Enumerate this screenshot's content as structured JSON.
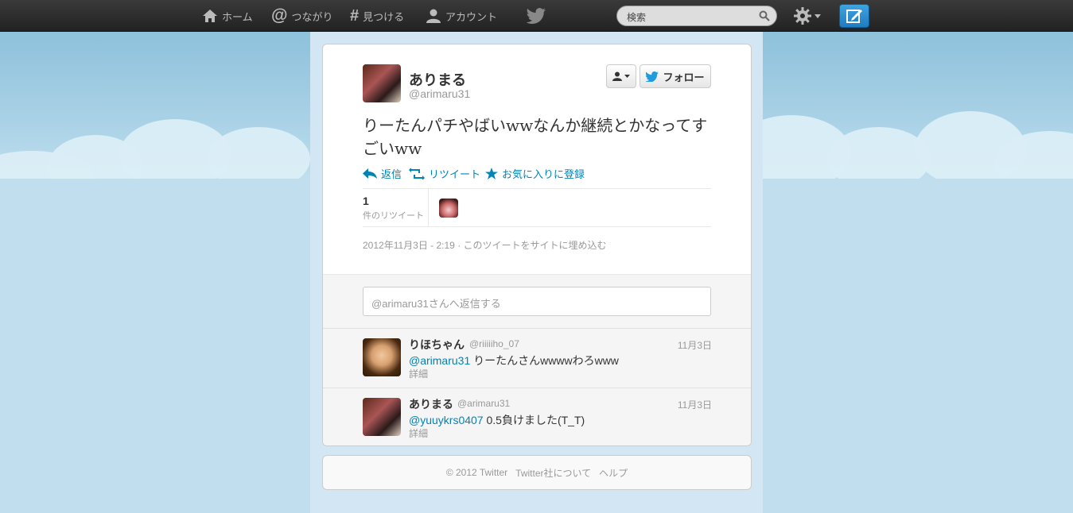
{
  "topbar": {
    "nav": [
      {
        "label": "ホーム",
        "icon": "home-icon"
      },
      {
        "label": "つながり",
        "icon": "at-icon"
      },
      {
        "label": "見つける",
        "icon": "hash-icon"
      },
      {
        "label": "アカウント",
        "icon": "user-icon"
      }
    ],
    "search_placeholder": "検索"
  },
  "tweet": {
    "author_name": "ありまる",
    "author_handle": "@arimaru31",
    "follow_label": "フォロー",
    "text": "りーたんパチやばいwwなんか継続とかなってすごいww",
    "actions": {
      "reply": "返信",
      "retweet": "リツイート",
      "favorite": "お気に入りに登録"
    },
    "retweet_count": "1",
    "retweet_label": "件のリツイート",
    "timestamp": "2012年11月3日 - 2:19",
    "embed_label": "このツイートをサイトに埋め込む"
  },
  "reply_box": {
    "placeholder": "@arimaru31さんへ返信する"
  },
  "replies": [
    {
      "name": "りほちゃん",
      "handle": "@riiiiiho_07",
      "date": "11月3日",
      "mention": "@arimaru31",
      "text": " りーたんさんwwwwわろwww",
      "detail": "詳細"
    },
    {
      "name": "ありまる",
      "handle": "@arimaru31",
      "date": "11月3日",
      "mention": "@yuuykrs0407",
      "text": " 0.5負けました(T_T)",
      "detail": "詳細"
    }
  ],
  "footer": {
    "copyright": "© 2012 Twitter",
    "about": "Twitter社について",
    "help": "ヘルプ"
  },
  "colors": {
    "link": "#0084b4",
    "topbar": "#2a2a2a",
    "background": "#c0deed"
  }
}
